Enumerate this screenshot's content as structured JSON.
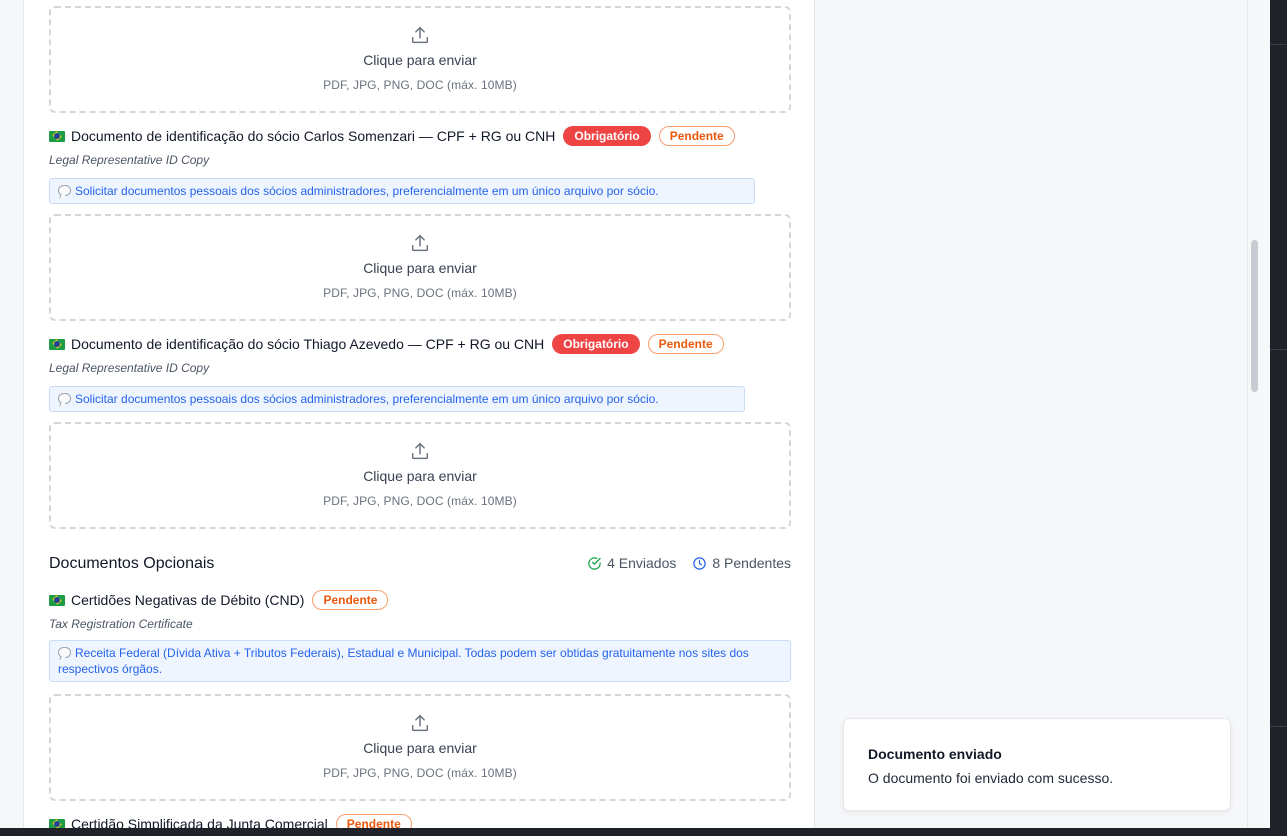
{
  "upload": {
    "label": "Clique para enviar",
    "hint": "PDF, JPG, PNG, DOC (máx. 10MB)"
  },
  "required_docs": [
    {
      "title": "Documento de identificação do sócio Carlos Somenzari — CPF + RG ou CNH",
      "badge_required": "Obrigatório",
      "badge_status": "Pendente",
      "subtitle": "Legal Representative ID Copy",
      "note": "Solicitar documentos pessoais dos sócios administradores, preferencialmente em um único arquivo por sócio."
    },
    {
      "title": "Documento de identificação do sócio Thiago Azevedo — CPF + RG ou CNH",
      "badge_required": "Obrigatório",
      "badge_status": "Pendente",
      "subtitle": "Legal Representative ID Copy",
      "note": "Solicitar documentos pessoais dos sócios administradores, preferencialmente em um único arquivo por sócio."
    }
  ],
  "optional_section": {
    "title": "Documentos Opcionais",
    "sent_label": "4 Enviados",
    "pending_label": "8 Pendentes"
  },
  "optional_docs": [
    {
      "title": "Certidões Negativas de Débito (CND)",
      "badge_status": "Pendente",
      "subtitle": "Tax Registration Certificate",
      "note": "Receita Federal (Dívida Ativa + Tributos Federais), Estadual e Municipal. Todas podem ser obtidas gratuitamente nos sites dos respectivos órgãos."
    },
    {
      "title": "Certidão Simplificada da Junta Comercial",
      "badge_status": "Pendente"
    }
  ],
  "toast": {
    "title": "Documento enviado",
    "message": "O documento foi enviado com sucesso."
  },
  "colors": {
    "required_badge": "#ef4444",
    "pending_badge": "#ea580c",
    "note_text": "#2563eb",
    "sent_icon": "#16a34a",
    "pending_icon": "#2563eb"
  },
  "icons": {
    "upload": "upload-icon",
    "flag": "brazil-flag-icon",
    "note": "speech-bubble-icon",
    "sent": "check-circle-icon",
    "pending": "clock-icon"
  }
}
